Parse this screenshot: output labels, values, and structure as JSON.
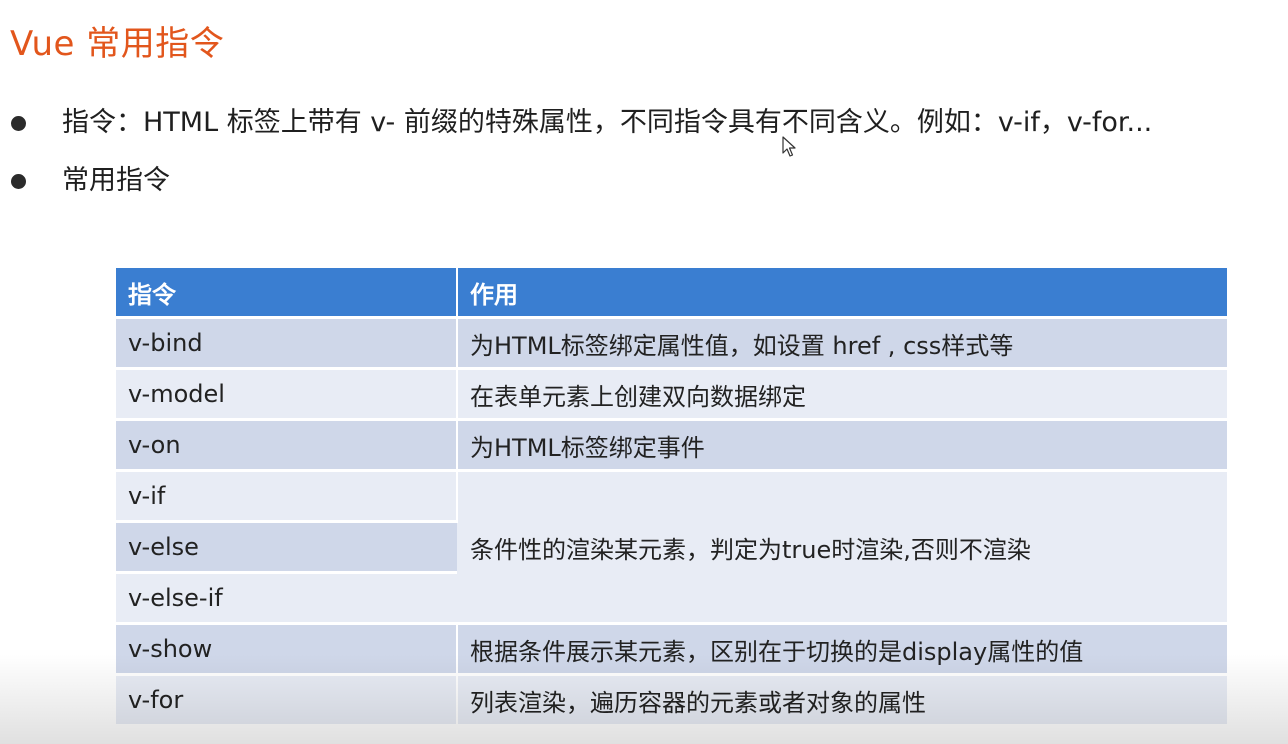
{
  "slide": {
    "title": "Vue 常用指令",
    "bullets": [
      "指令：HTML 标签上带有 v- 前缀的特殊属性，不同指令具有不同含义。例如：v-if，v-for...",
      "常用指令"
    ]
  },
  "table": {
    "headers": [
      "指令",
      "作用"
    ],
    "rows": [
      {
        "directive": "v-bind",
        "effect": "为HTML标签绑定属性值，如设置 href , css样式等"
      },
      {
        "directive": "v-model",
        "effect": "在表单元素上创建双向数据绑定"
      },
      {
        "directive": "v-on",
        "effect": "为HTML标签绑定事件"
      },
      {
        "directive": "v-if",
        "effect": "条件性的渲染某元素，判定为true时渲染,否则不渲染"
      },
      {
        "directive": "v-else",
        "effect": ""
      },
      {
        "directive": "v-else-if",
        "effect": ""
      },
      {
        "directive": "v-show",
        "effect": "根据条件展示某元素，区别在于切换的是display属性的值"
      },
      {
        "directive": "v-for",
        "effect": "列表渲染，遍历容器的元素或者对象的属性"
      }
    ]
  },
  "colors": {
    "title": "#e2561c",
    "header_bg": "#3a7ed1",
    "row_dark": "#cfd7e9",
    "row_light": "#e8ecf5"
  },
  "icons": {
    "cursor": "mouse-pointer-icon",
    "bullet": "bullet-dot-icon"
  }
}
